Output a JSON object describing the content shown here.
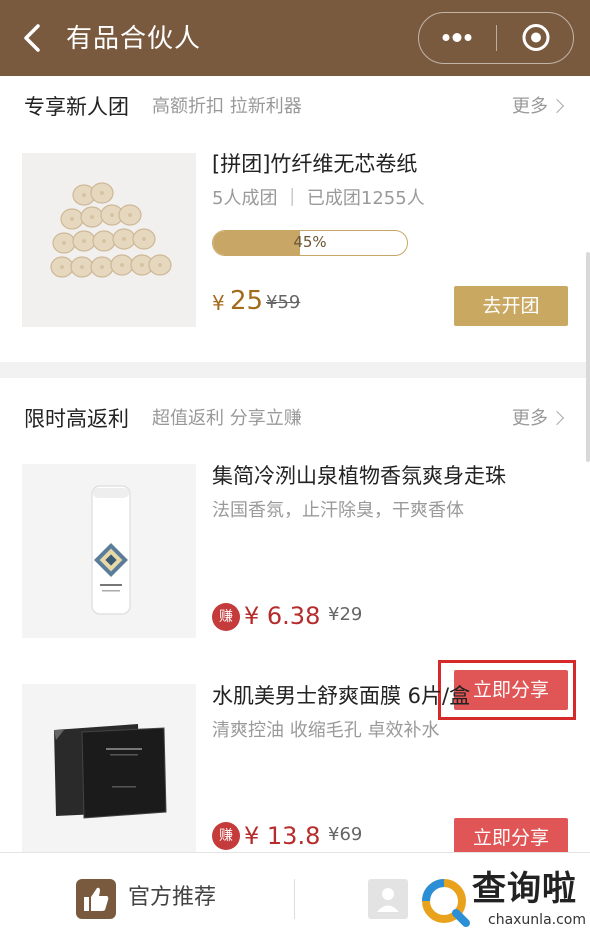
{
  "header": {
    "title": "有品合伙人",
    "back_icon": "chevron-left-icon",
    "more_icon": "more-dots-icon",
    "close_icon": "target-close-icon",
    "bg_color": "#7a5a3f"
  },
  "section_group": {
    "title": "专享新人团",
    "subtitle": "高额折扣 拉新利器",
    "more_label": "更多",
    "product": {
      "name": "[拼团]竹纤维无芯卷纸",
      "desc": "5人成团 ｜ 已成团1255人",
      "progress_label": "45%",
      "progress_value": 0.45,
      "currency": "¥",
      "price": "25",
      "original_price": "¥59",
      "button_label": "去开团"
    }
  },
  "section_rebate": {
    "title": "限时高返利",
    "subtitle": "超值返利 分享立赚",
    "more_label": "更多",
    "products": [
      {
        "name": "集简冷洌山泉植物香氛爽身走珠",
        "desc": "法国香氛，止汗除臭，干爽香体",
        "badge": "赚",
        "price": "¥ 6.38",
        "original_price": "¥29",
        "button_label": "立即分享"
      },
      {
        "name": "水肌美男士舒爽面膜 6片/盒",
        "desc": "清爽控油 收缩毛孔 卓效补水",
        "badge": "赚",
        "price": "¥ 13.8",
        "original_price": "¥69",
        "button_label": "立即分享"
      }
    ]
  },
  "bottom_bar": {
    "recommend_label": "官方推荐",
    "recommend_icon": "thumbs-up-icon",
    "user_icon": "user-icon"
  },
  "watermark": {
    "logo_text": "查询啦",
    "logo_sub": "chaxunla.com"
  },
  "colors": {
    "accent_gold": "#c9a862",
    "button_red": "#e05555",
    "earn_red": "#b62c2c"
  }
}
